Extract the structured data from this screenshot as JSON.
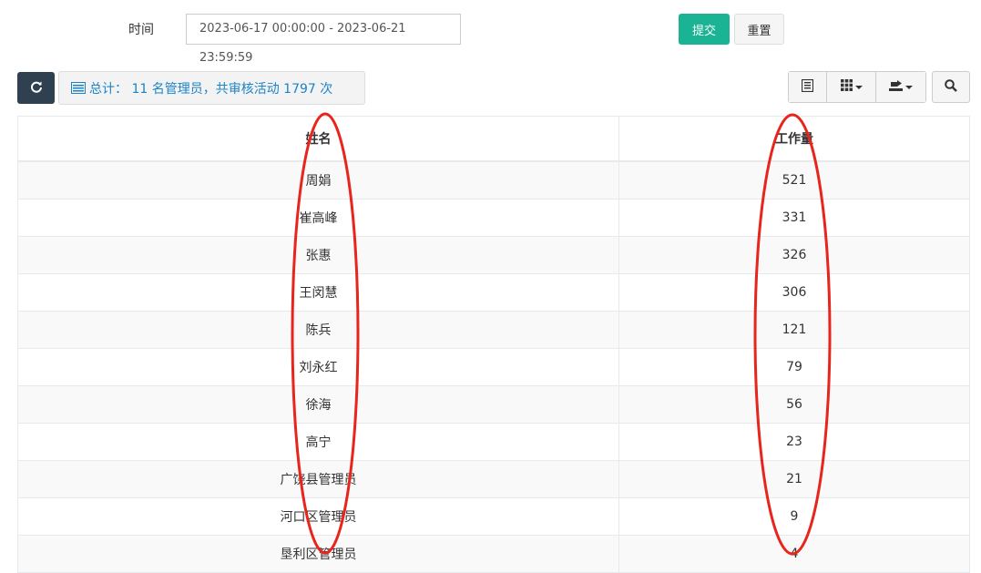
{
  "filter": {
    "time_label": "时间",
    "time_range": "2023-06-17 00:00:00 - 2023-06-21 23:59:59",
    "submit_label": "提交",
    "reset_label": "重置"
  },
  "toolbar": {
    "summary_text": "总计： 11 名管理员，共审核活动 1797 次"
  },
  "table": {
    "headers": [
      "姓名",
      "工作量"
    ],
    "rows": [
      [
        "周娟",
        "521"
      ],
      [
        "崔高峰",
        "331"
      ],
      [
        "张惠",
        "326"
      ],
      [
        "王闵慧",
        "306"
      ],
      [
        "陈兵",
        "121"
      ],
      [
        "刘永红",
        "79"
      ],
      [
        "徐海",
        "56"
      ],
      [
        "高宁",
        "23"
      ],
      [
        "广饶县管理员",
        "21"
      ],
      [
        "河口区管理员",
        "9"
      ],
      [
        "垦利区管理员",
        "4"
      ]
    ]
  },
  "colors": {
    "submit": "#1ab394",
    "refresh": "#2f4050",
    "summary_text": "#1c84c6",
    "annotation": "#e8251c"
  }
}
